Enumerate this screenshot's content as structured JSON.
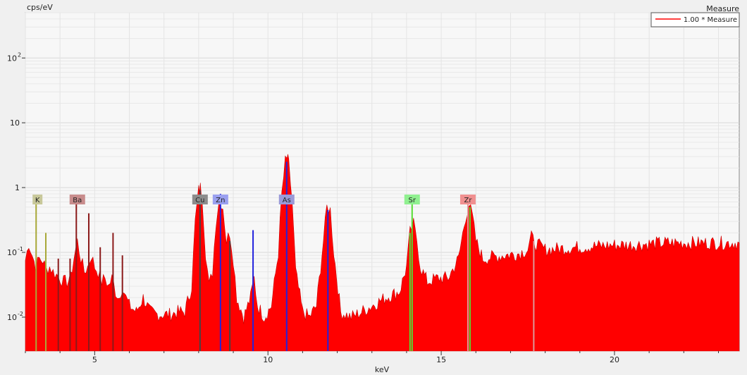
{
  "chart_data": {
    "type": "area",
    "title": "Measure",
    "xlabel": "keV",
    "ylabel": "cps/eV",
    "x_range": [
      3.0,
      23.6
    ],
    "y_scale": "log",
    "y_range": [
      0.003,
      500
    ],
    "x_ticks": [
      5,
      10,
      15,
      20
    ],
    "x_tick_labels": [
      "5",
      "10",
      "15",
      "20"
    ],
    "y_ticks": [
      0.01,
      0.1,
      1,
      10,
      100
    ],
    "y_tick_labels": [
      "10",
      "10",
      "1",
      "10",
      "10"
    ],
    "y_tick_superscripts": [
      "-2",
      "-1",
      "",
      "",
      "2"
    ],
    "grid": true,
    "legend_position": "top-right",
    "series": [
      {
        "name": "1.00 * Measure",
        "color": "#ff0000",
        "points": [
          [
            3.0,
            0.075
          ],
          [
            3.1,
            0.14
          ],
          [
            3.2,
            0.09
          ],
          [
            3.3,
            0.06
          ],
          [
            3.4,
            0.08
          ],
          [
            3.5,
            0.075
          ],
          [
            3.6,
            0.055
          ],
          [
            3.7,
            0.06
          ],
          [
            3.8,
            0.05
          ],
          [
            3.9,
            0.045
          ],
          [
            4.0,
            0.04
          ],
          [
            4.1,
            0.035
          ],
          [
            4.2,
            0.035
          ],
          [
            4.3,
            0.04
          ],
          [
            4.4,
            0.08
          ],
          [
            4.5,
            0.15
          ],
          [
            4.6,
            0.08
          ],
          [
            4.7,
            0.05
          ],
          [
            4.8,
            0.06
          ],
          [
            4.9,
            0.09
          ],
          [
            5.0,
            0.06
          ],
          [
            5.1,
            0.05
          ],
          [
            5.2,
            0.035
          ],
          [
            5.3,
            0.04
          ],
          [
            5.4,
            0.03
          ],
          [
            5.5,
            0.04
          ],
          [
            5.6,
            0.025
          ],
          [
            5.7,
            0.02
          ],
          [
            5.8,
            0.03
          ],
          [
            5.9,
            0.02
          ],
          [
            6.0,
            0.015
          ],
          [
            6.2,
            0.012
          ],
          [
            6.4,
            0.02
          ],
          [
            6.6,
            0.012
          ],
          [
            6.8,
            0.011
          ],
          [
            7.0,
            0.011
          ],
          [
            7.2,
            0.011
          ],
          [
            7.4,
            0.012
          ],
          [
            7.6,
            0.012
          ],
          [
            7.8,
            0.03
          ],
          [
            7.9,
            0.3
          ],
          [
            8.0,
            0.9
          ],
          [
            8.05,
            1.0
          ],
          [
            8.1,
            0.8
          ],
          [
            8.2,
            0.1
          ],
          [
            8.3,
            0.03
          ],
          [
            8.4,
            0.05
          ],
          [
            8.5,
            0.3
          ],
          [
            8.6,
            0.7
          ],
          [
            8.7,
            0.5
          ],
          [
            8.8,
            0.15
          ],
          [
            8.9,
            0.2
          ],
          [
            9.0,
            0.08
          ],
          [
            9.1,
            0.02
          ],
          [
            9.3,
            0.01
          ],
          [
            9.5,
            0.02
          ],
          [
            9.6,
            0.04
          ],
          [
            9.7,
            0.015
          ],
          [
            9.9,
            0.01
          ],
          [
            10.1,
            0.015
          ],
          [
            10.3,
            0.1
          ],
          [
            10.4,
            0.8
          ],
          [
            10.5,
            2.5
          ],
          [
            10.55,
            2.9
          ],
          [
            10.6,
            2.3
          ],
          [
            10.7,
            0.6
          ],
          [
            10.8,
            0.05
          ],
          [
            11.0,
            0.012
          ],
          [
            11.2,
            0.01
          ],
          [
            11.4,
            0.015
          ],
          [
            11.6,
            0.15
          ],
          [
            11.7,
            0.5
          ],
          [
            11.8,
            0.45
          ],
          [
            11.9,
            0.1
          ],
          [
            12.1,
            0.012
          ],
          [
            12.4,
            0.01
          ],
          [
            12.7,
            0.012
          ],
          [
            13.0,
            0.015
          ],
          [
            13.4,
            0.02
          ],
          [
            13.8,
            0.025
          ],
          [
            14.0,
            0.06
          ],
          [
            14.1,
            0.2
          ],
          [
            14.2,
            0.27
          ],
          [
            14.3,
            0.15
          ],
          [
            14.4,
            0.06
          ],
          [
            14.6,
            0.035
          ],
          [
            14.9,
            0.04
          ],
          [
            15.2,
            0.04
          ],
          [
            15.5,
            0.08
          ],
          [
            15.7,
            0.35
          ],
          [
            15.8,
            0.55
          ],
          [
            15.9,
            0.35
          ],
          [
            16.0,
            0.15
          ],
          [
            16.2,
            0.08
          ],
          [
            16.5,
            0.085
          ],
          [
            16.8,
            0.09
          ],
          [
            17.2,
            0.095
          ],
          [
            17.5,
            0.11
          ],
          [
            17.6,
            0.17
          ],
          [
            17.7,
            0.14
          ],
          [
            18.0,
            0.11
          ],
          [
            18.5,
            0.115
          ],
          [
            19.0,
            0.12
          ],
          [
            19.5,
            0.125
          ],
          [
            20.0,
            0.13
          ],
          [
            20.5,
            0.13
          ],
          [
            21.0,
            0.135
          ],
          [
            21.5,
            0.14
          ],
          [
            22.0,
            0.14
          ],
          [
            22.5,
            0.14
          ],
          [
            23.0,
            0.14
          ],
          [
            23.6,
            0.14
          ]
        ]
      }
    ],
    "element_lines": [
      {
        "element": "K",
        "color": "#a8a838",
        "lines": [
          [
            3.31,
            0.6
          ],
          [
            3.59,
            0.2
          ]
        ]
      },
      {
        "element": "Ba",
        "color": "#8b1a1a",
        "lines": [
          [
            4.47,
            0.6
          ],
          [
            4.83,
            0.4
          ],
          [
            4.29,
            0.08
          ],
          [
            5.16,
            0.12
          ],
          [
            5.53,
            0.2
          ],
          [
            3.95,
            0.08
          ],
          [
            5.8,
            0.09
          ]
        ]
      },
      {
        "element": "Cu",
        "color": "#444444",
        "lines": [
          [
            8.04,
            0.9
          ],
          [
            8.9,
            0.15
          ]
        ]
      },
      {
        "element": "Zn",
        "color": "#2222dd",
        "lines": [
          [
            8.63,
            0.8
          ],
          [
            9.57,
            0.22
          ]
        ]
      },
      {
        "element": "As",
        "color": "#2222dd",
        "lines": [
          [
            10.54,
            2.5
          ],
          [
            11.73,
            0.45
          ]
        ]
      },
      {
        "element": "Sr",
        "color": "#55dd33",
        "lines": [
          [
            14.16,
            0.6
          ],
          [
            14.1,
            0.2
          ],
          [
            15.83,
            0.5
          ]
        ]
      },
      {
        "element": "Zr",
        "color": "#dd9999",
        "lines": [
          [
            15.77,
            0.55
          ],
          [
            17.67,
            0.15
          ]
        ]
      }
    ],
    "annotations": [
      {
        "label": "K",
        "x": 3.35,
        "color": "#c8c89a"
      },
      {
        "label": "Ba",
        "x": 4.5,
        "color": "#c88c8c"
      },
      {
        "label": "Cu",
        "x": 8.04,
        "color": "#8c8c8c"
      },
      {
        "label": "Zn",
        "x": 8.63,
        "color": "#9aa0f0"
      },
      {
        "label": "As",
        "x": 10.54,
        "color": "#9a9ad8"
      },
      {
        "label": "Sr",
        "x": 14.16,
        "color": "#90f090"
      },
      {
        "label": "Zr",
        "x": 15.77,
        "color": "#f09090"
      }
    ]
  }
}
